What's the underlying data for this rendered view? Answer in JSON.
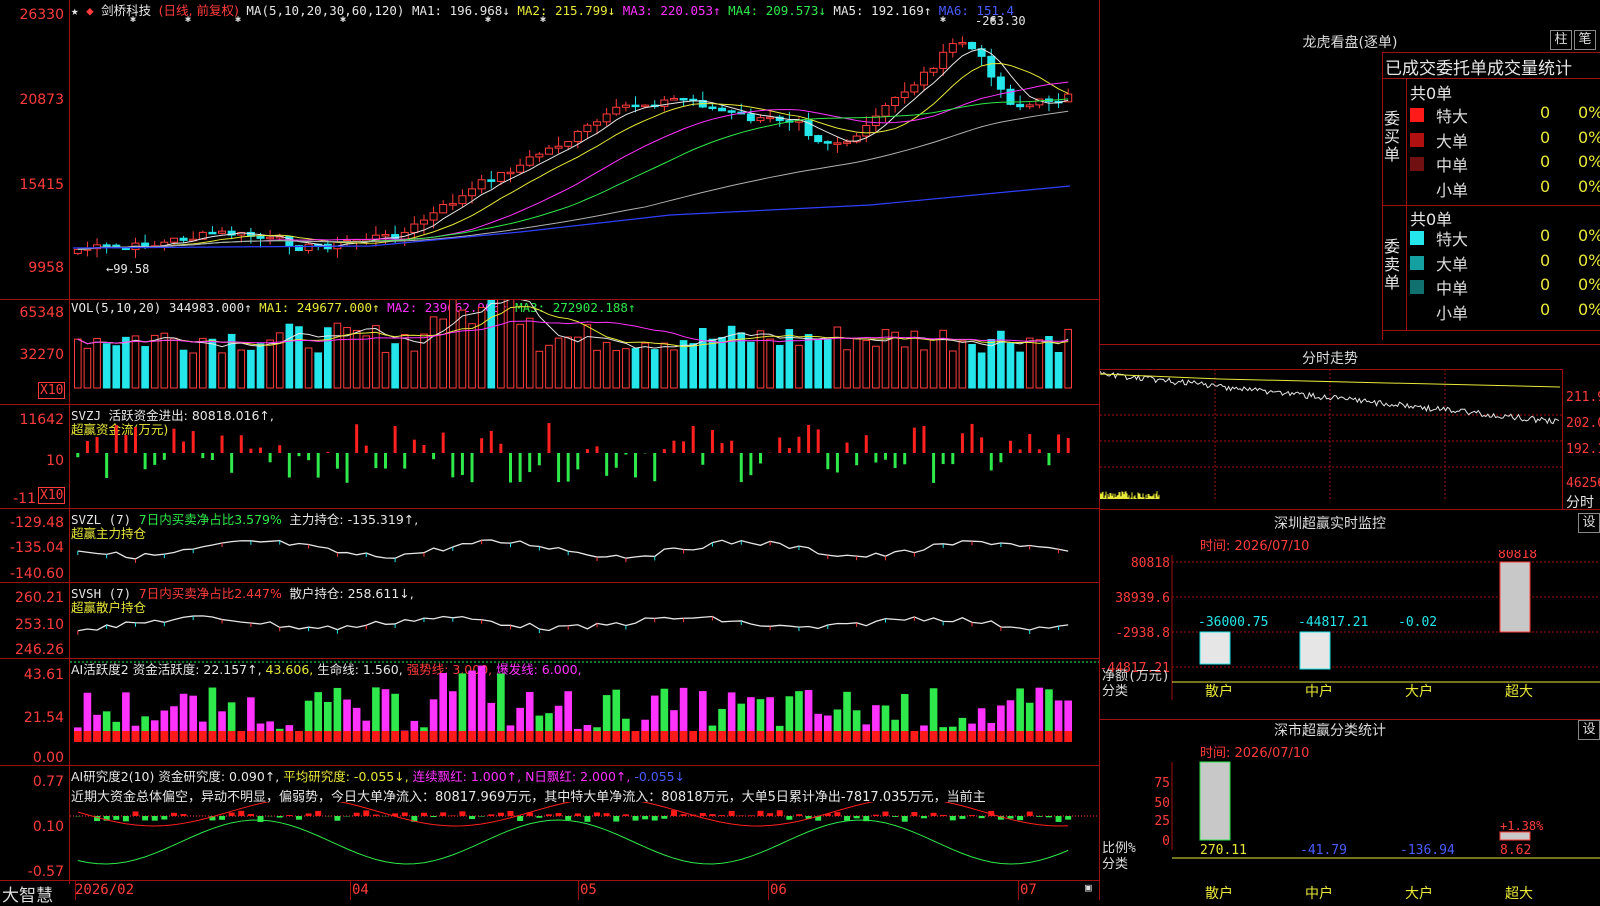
{
  "app": {
    "brand": "大智慧",
    "watermark": ""
  },
  "price_panel": {
    "stock": "剑桥科技",
    "mode": "(日线, 前复权)",
    "ma_params": "MA(5,10,20,30,60,120)",
    "ma": [
      {
        "name": "MA1:",
        "value": "196.968↓",
        "color": "#e6e6e6"
      },
      {
        "name": "MA2:",
        "value": "215.799↓",
        "color": "#e8e83a"
      },
      {
        "name": "MA3:",
        "value": "220.053↑",
        "color": "#ff33ff"
      },
      {
        "name": "MA4:",
        "value": "209.573↓",
        "color": "#2fe84b"
      },
      {
        "name": "MA5:",
        "value": "192.169↑",
        "color": "#e6e6e6"
      },
      {
        "name": "MA6:",
        "value": "151.4",
        "color": "#4a5cff"
      }
    ],
    "y_ticks": [
      "26330",
      "20873",
      "15415",
      "9958"
    ],
    "high_label": "263.30",
    "low_label": "←99.58"
  },
  "vol_panel": {
    "header": "VOL(5,10,20)",
    "vol": "344983.000↑",
    "ma1": "MA1: 249677.000↑",
    "ma2": "MA2: 239662.906↑",
    "ma3": "MA3: 272902.188↑",
    "y_ticks": [
      "65348",
      "32270"
    ],
    "unit": "X10"
  },
  "svzj_panel": {
    "header": "SVZJ",
    "item": "活跃资金进出: 80818.016↑,",
    "sub": "超赢资金流(万元)",
    "y_ticks": [
      "11642",
      "10",
      "-11"
    ],
    "unit": "X10"
  },
  "svzl_panel": {
    "header": "SVZL (7)",
    "item1": "7日内买卖净占比3.579%",
    "item2": "主力持仓: -135.319↑,",
    "sub": "超赢主力持仓",
    "y_ticks": [
      "-129.48",
      "-135.04",
      "-140.60"
    ]
  },
  "svsh_panel": {
    "header": "SVSH (7)",
    "item1": "7日内买卖净占比2.447%",
    "item2": "散户持仓: 258.611↓,",
    "sub": "超赢散户持仓",
    "y_ticks": [
      "260.21",
      "253.10",
      "246.26"
    ]
  },
  "ai_active_panel": {
    "header": "AI活跃度2",
    "item1": "资金活跃度: 22.157↑,",
    "item2": "43.606,",
    "item3": "生命线: 1.560,",
    "item4": "强势线: 3.000,",
    "item5": "爆发线: 6.000,",
    "y_ticks": [
      "43.61",
      "21.54",
      "0.00"
    ]
  },
  "ai_research_panel": {
    "header": "AI研究度2(10)",
    "item1": "资金研究度: 0.090↑,",
    "item2": "平均研究度: -0.055↓,",
    "item3": "连续飘红: 1.000↑,",
    "item4": "N日飘红: 2.000↑,",
    "item5": "-0.055↓",
    "comment": "近期大资金总体偏空，异动不明显，偏弱势，今日大单净流入：80817.969万元，其中特大单净流入：80818万元，大单5日累计净出-7817.035万元，当前主",
    "y_ticks": [
      "0.77",
      "0.10",
      "-0.57"
    ]
  },
  "x_axis": [
    "2026/02",
    "04",
    "05",
    "06",
    "07"
  ],
  "dragon": {
    "title": "龙虎看盘(逐单)",
    "btn1": "柱",
    "btn2": "笔",
    "tabs": "已成交委托单成交量统计",
    "buy_total": "共0单",
    "sell_total": "共0单",
    "buy_label": "委买单",
    "sell_label": "委卖单",
    "rows_buy": [
      {
        "name": "特大",
        "count": "0",
        "pct": "0%",
        "color": "#ff1a1a"
      },
      {
        "name": "大单",
        "count": "0",
        "pct": "0%",
        "color": "#b01010"
      },
      {
        "name": "中单",
        "count": "0",
        "pct": "0%",
        "color": "#701010"
      },
      {
        "name": "小单",
        "count": "0",
        "pct": "0%",
        "color": "#000000"
      }
    ],
    "rows_sell": [
      {
        "name": "特大",
        "count": "0",
        "pct": "0%",
        "color": "#25e6ea"
      },
      {
        "name": "大单",
        "count": "0",
        "pct": "0%",
        "color": "#14a0a0"
      },
      {
        "name": "中单",
        "count": "0",
        "pct": "0%",
        "color": "#107070"
      },
      {
        "name": "小单",
        "count": "0",
        "pct": "0%",
        "color": "#000000"
      }
    ]
  },
  "intraday": {
    "title": "分时走势",
    "ticks": [
      "211.9",
      "202.0",
      "192.1",
      "46256"
    ],
    "bottom_label": "分时"
  },
  "sz_monitor": {
    "title": "深圳超赢实时监控",
    "btn": "设",
    "time": "时间: 2026/07/10",
    "y_ticks": [
      "80818",
      "38939.6",
      "-2938.8",
      "-44817.21"
    ],
    "ylabel1": "净额(万元)",
    "ylabel2": "分类",
    "bars": [
      {
        "label": "散户",
        "value": "-36000.75"
      },
      {
        "label": "中户",
        "value": "-44817.21"
      },
      {
        "label": "大户",
        "value": "-0.02"
      },
      {
        "label": "超大",
        "value": "80818"
      }
    ]
  },
  "sz_class": {
    "title": "深市超赢分类统计",
    "btn": "设",
    "time": "时间: 2026/07/10",
    "y_ticks": [
      "75",
      "50",
      "25",
      "0"
    ],
    "ylabel1": "比例%",
    "ylabel2": "分类",
    "pct_label": "+1.38%",
    "bars": [
      {
        "label": "散户",
        "value": "270.11"
      },
      {
        "label": "中户",
        "value": "-41.79"
      },
      {
        "label": "大户",
        "value": "-136.94"
      },
      {
        "label": "超大",
        "value": "8.62"
      }
    ]
  }
}
